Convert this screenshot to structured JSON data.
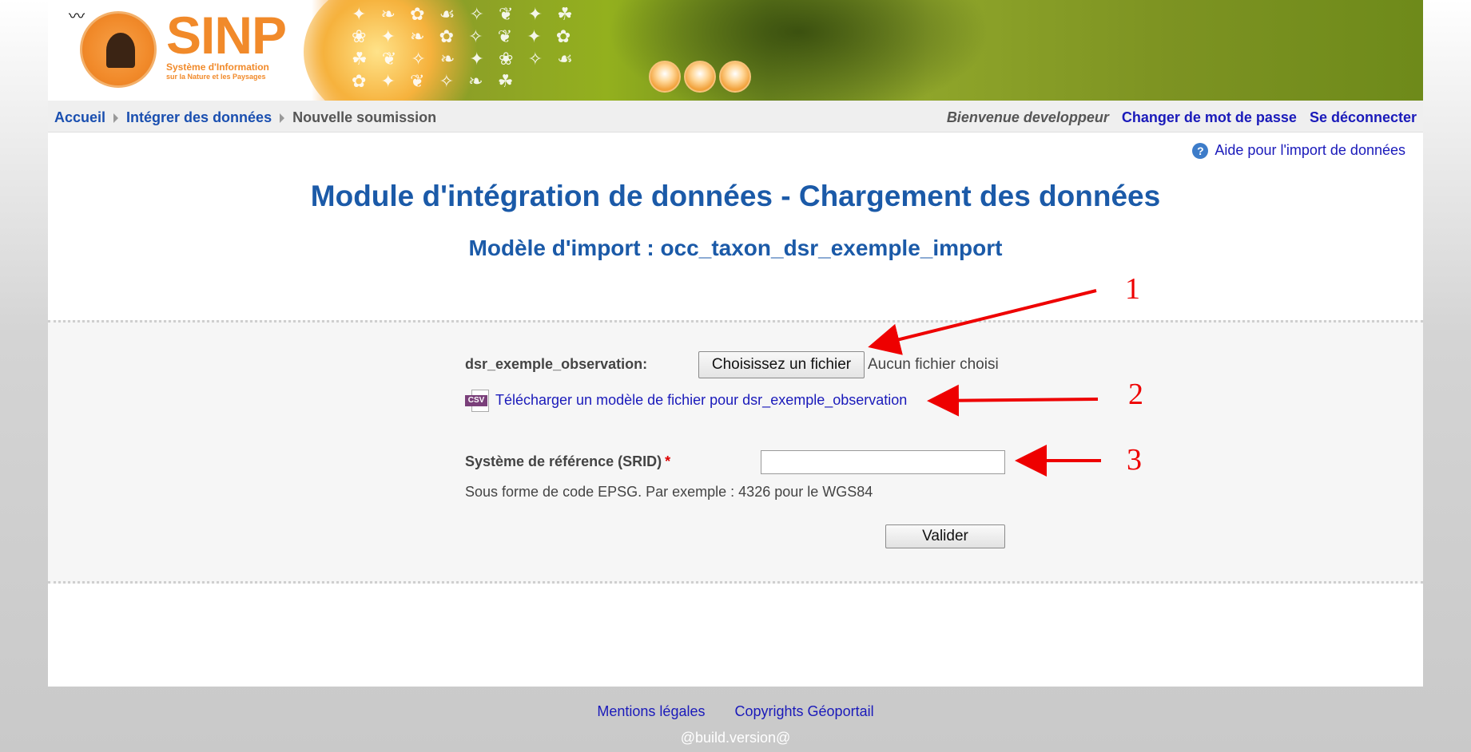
{
  "banner": {
    "logo_text": "SINP",
    "logo_line1": "Système d'Information",
    "logo_line2": "sur la Nature et les Paysages"
  },
  "breadcrumb": {
    "home": "Accueil",
    "integrate": "Intégrer des données",
    "current": "Nouvelle soumission"
  },
  "user": {
    "welcome": "Bienvenue developpeur",
    "change_password": "Changer de mot de passe",
    "logout": "Se déconnecter"
  },
  "help": {
    "icon": "question-icon",
    "label": "Aide pour l'import de données"
  },
  "main": {
    "title": "Module d'intégration de données - Chargement des données",
    "subtitle": "Modèle d'import : occ_taxon_dsr_exemple_import"
  },
  "form": {
    "file_label": "dsr_exemple_observation:",
    "file_button": "Choisissez un fichier",
    "file_status": "Aucun fichier choisi",
    "csv_icon": "csv-file-icon",
    "csv_tag": "CSV",
    "download_link": "Télécharger un modèle de fichier pour dsr_exemple_observation",
    "srid_label": "Système de référence (SRID)",
    "srid_required": "*",
    "srid_value": "",
    "srid_hint": "Sous forme de code EPSG. Par exemple : 4326 pour le WGS84",
    "submit": "Valider"
  },
  "annotations": [
    "1",
    "2",
    "3"
  ],
  "footer": {
    "legal": "Mentions légales",
    "copyright": "Copyrights Géoportail",
    "version": "@build.version@"
  },
  "colors": {
    "title_blue": "#1b5aa8",
    "link_blue": "#1a1aba",
    "annotation_red": "#e00000",
    "banner_green": "#7d9322",
    "logo_orange": "#f18a2a"
  }
}
